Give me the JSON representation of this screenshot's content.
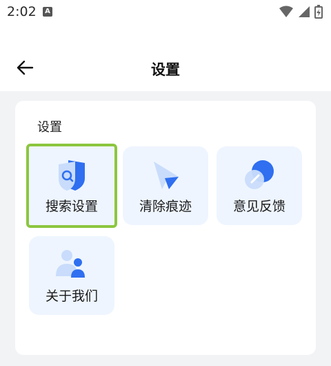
{
  "status_bar": {
    "time": "2:02",
    "notification_letter": "A"
  },
  "header": {
    "title": "设置"
  },
  "section": {
    "title": "设置"
  },
  "tiles": [
    {
      "label": "搜索设置",
      "icon": "search-shield-icon",
      "selected": true
    },
    {
      "label": "清除痕迹",
      "icon": "cursor-arrow-icon"
    },
    {
      "label": "意见反馈",
      "icon": "feedback-pen-icon"
    },
    {
      "label": "关于我们",
      "icon": "people-icon"
    }
  ],
  "colors": {
    "tile_bg": "#eef5ff",
    "accent_blue": "#2f6ff0",
    "selection_outline": "#8cc63f"
  }
}
